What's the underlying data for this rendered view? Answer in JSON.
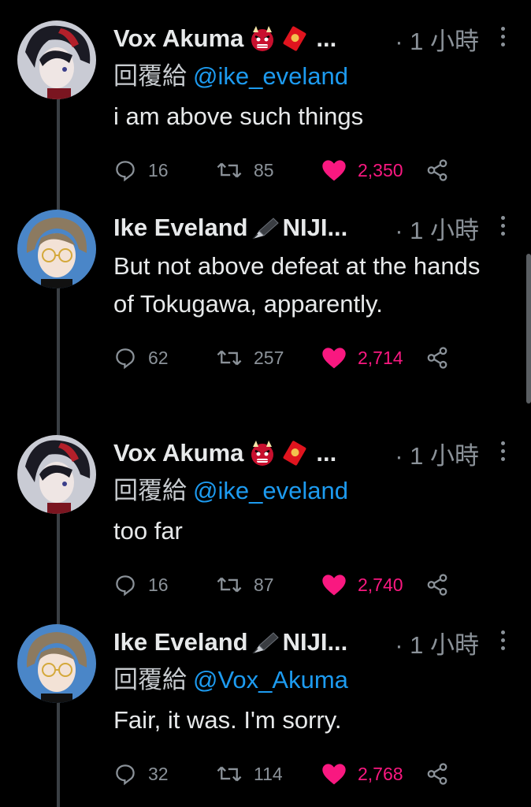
{
  "tweets": [
    {
      "name": "Vox Akuma",
      "ellipsis": "...",
      "time": "· 1 小時",
      "reply_prefix": "回覆給",
      "reply_handle": "@ike_eveland",
      "text": "i am above such things",
      "replies": "16",
      "retweets": "85",
      "likes": "2,350"
    },
    {
      "name": "Ike Eveland",
      "ellipsis": "NIJI...",
      "time": "· 1 小時",
      "text": "But not above defeat at the hands of Tokugawa, apparently.",
      "replies": "62",
      "retweets": "257",
      "likes": "2,714"
    },
    {
      "name": "Vox Akuma",
      "ellipsis": "...",
      "time": "· 1 小時",
      "reply_prefix": "回覆給",
      "reply_handle": "@ike_eveland",
      "text": "too far",
      "replies": "16",
      "retweets": "87",
      "likes": "2,740"
    },
    {
      "name": "Ike Eveland",
      "ellipsis": "NIJI...",
      "time": "· 1 小時",
      "reply_prefix": "回覆給",
      "reply_handle": "@Vox_Akuma",
      "text": "Fair, it was. I'm sorry.",
      "replies": "32",
      "retweets": "114",
      "likes": "2,768"
    }
  ],
  "icons": {
    "oni": "oni-mask-icon",
    "envelope": "red-envelope-icon",
    "pen": "fountain-pen-icon",
    "reply": "reply-icon",
    "retweet": "retweet-icon",
    "like": "heart-icon",
    "share": "share-icon",
    "more": "more-icon"
  },
  "colors": {
    "background": "#000000",
    "link": "#1d9bf0",
    "like": "#f91880",
    "muted": "#8b9299"
  }
}
